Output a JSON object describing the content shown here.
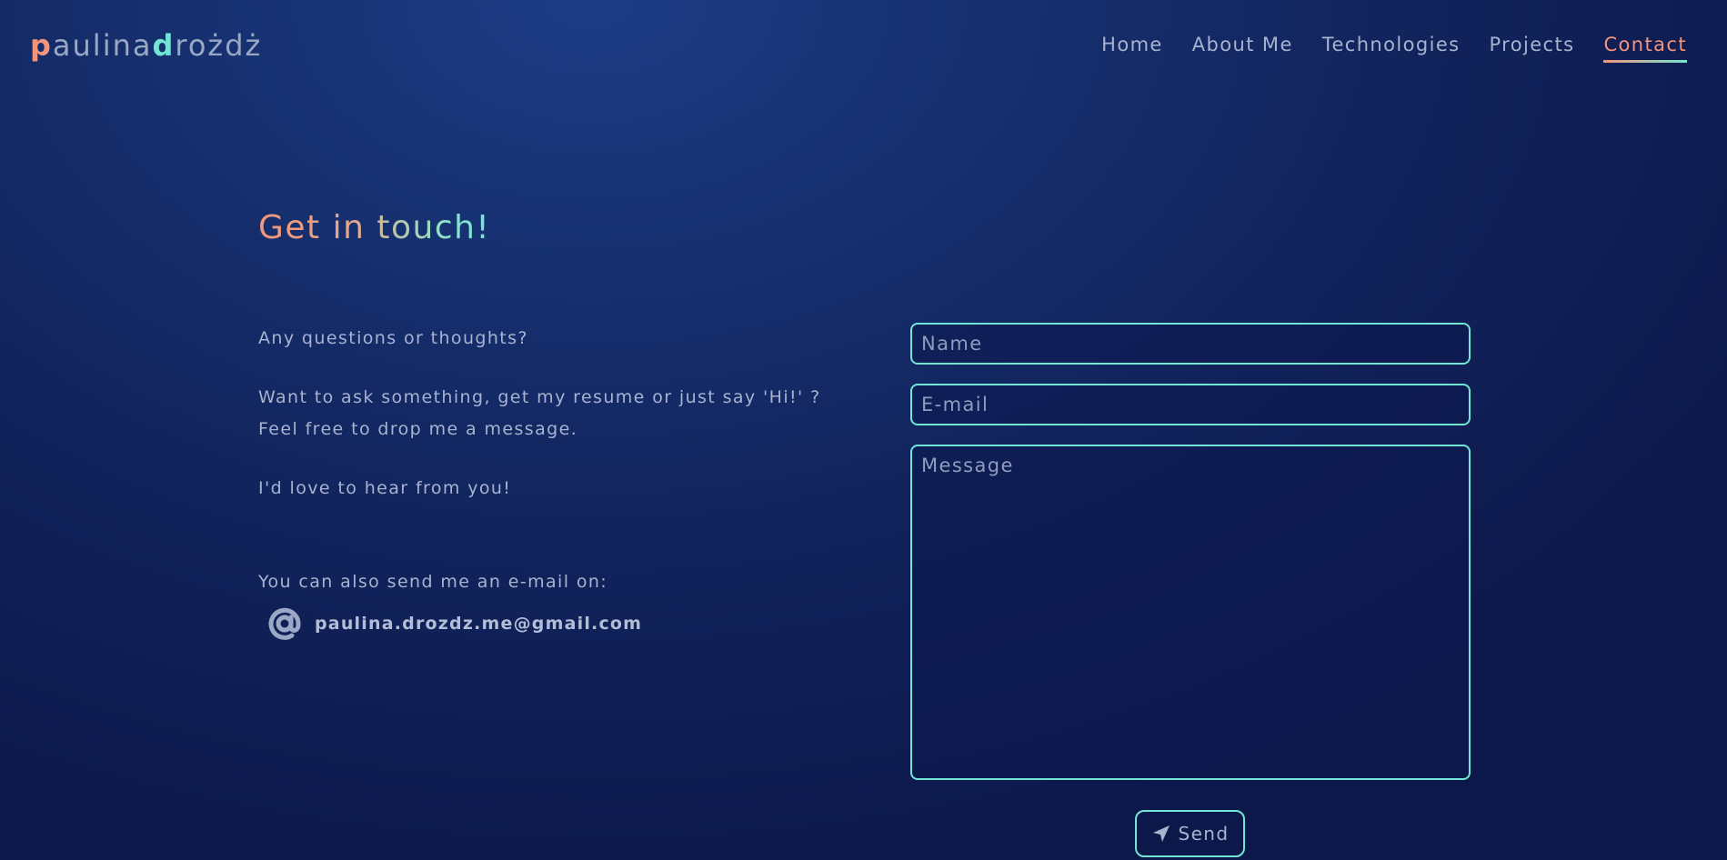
{
  "header": {
    "logo": {
      "part1_accent": "p",
      "part1_rest": "aulina",
      "part2_accent": "d",
      "part2_rest": "rożdż"
    },
    "nav": [
      {
        "label": "Home",
        "active": false
      },
      {
        "label": "About Me",
        "active": false
      },
      {
        "label": "Technologies",
        "active": false
      },
      {
        "label": "Projects",
        "active": false
      },
      {
        "label": "Contact",
        "active": true
      }
    ]
  },
  "contact": {
    "title": "Get in touch!",
    "intro": "Any questions or thoughts?",
    "body_line1": "Want to ask something, get my resume or just say 'Hi!' ?",
    "body_line2": "Feel free to drop me a message.",
    "closing": "I'd love to hear from you!",
    "email_intro": "You can also send me an e-mail on:",
    "email": "paulina.drozdz.me@gmail.com",
    "icon": "at-sign-icon"
  },
  "form": {
    "name_placeholder": "Name",
    "email_placeholder": "E-mail",
    "message_placeholder": "Message",
    "send_label": "Send",
    "send_icon": "paper-plane-icon"
  },
  "colors": {
    "accent_orange": "#f2957b",
    "accent_teal": "#72e6d4",
    "text": "#a7b3cf",
    "background_dark": "#0c174a",
    "background_light": "#1d3c86"
  }
}
